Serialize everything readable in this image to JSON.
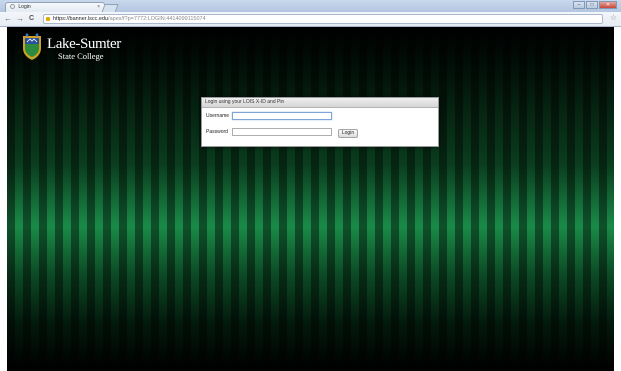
{
  "browser": {
    "tab_title": "Login",
    "tab_close": "×",
    "url_host": "https://banner.lscc.edu",
    "url_path": "/apex/f?p=7772:LOGIN:4414099115074",
    "nav": {
      "back": "←",
      "forward": "→",
      "reload": "C"
    },
    "star": "☆",
    "window_controls": {
      "minimize": "–",
      "maximize": "□",
      "close": "✕"
    }
  },
  "brand": {
    "line1": "Lake-Sumter",
    "line2": "State College",
    "colors": {
      "shield_gold": "#c9a227",
      "shield_blue": "#2a4f9c",
      "shield_green": "#2e8b3d"
    }
  },
  "login": {
    "header": "Login using your LOIS X-ID and Pin",
    "username_label": "Username",
    "password_label": "Password",
    "username_value": "",
    "password_value": "",
    "button_label": "Login"
  },
  "theme": {
    "stripe_green": "#1a8a48",
    "background_dark": "#000000"
  }
}
